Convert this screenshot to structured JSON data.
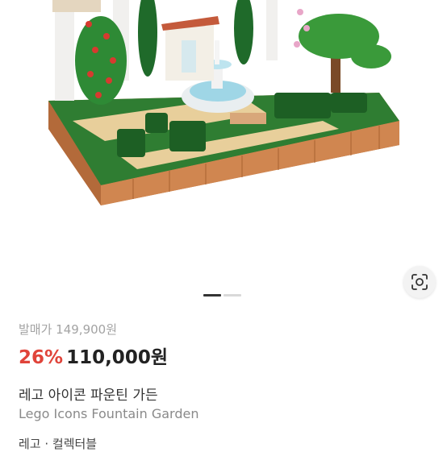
{
  "product": {
    "original_price_label": "발매가 149,900원",
    "discount_rate": "26%",
    "sale_price": "110,000원",
    "title_ko": "레고 아이콘 파운틴 가든",
    "title_en": "Lego Icons Fountain Garden",
    "brand_line": "레고 · 컬렉터블"
  },
  "image": {
    "alt": "Lego Icons Fountain Garden set",
    "carousel_total": 2,
    "carousel_active": 1
  },
  "icons": {
    "lens": "lens-search-icon"
  },
  "colors": {
    "discount": "#e0443a",
    "price": "#222222"
  }
}
